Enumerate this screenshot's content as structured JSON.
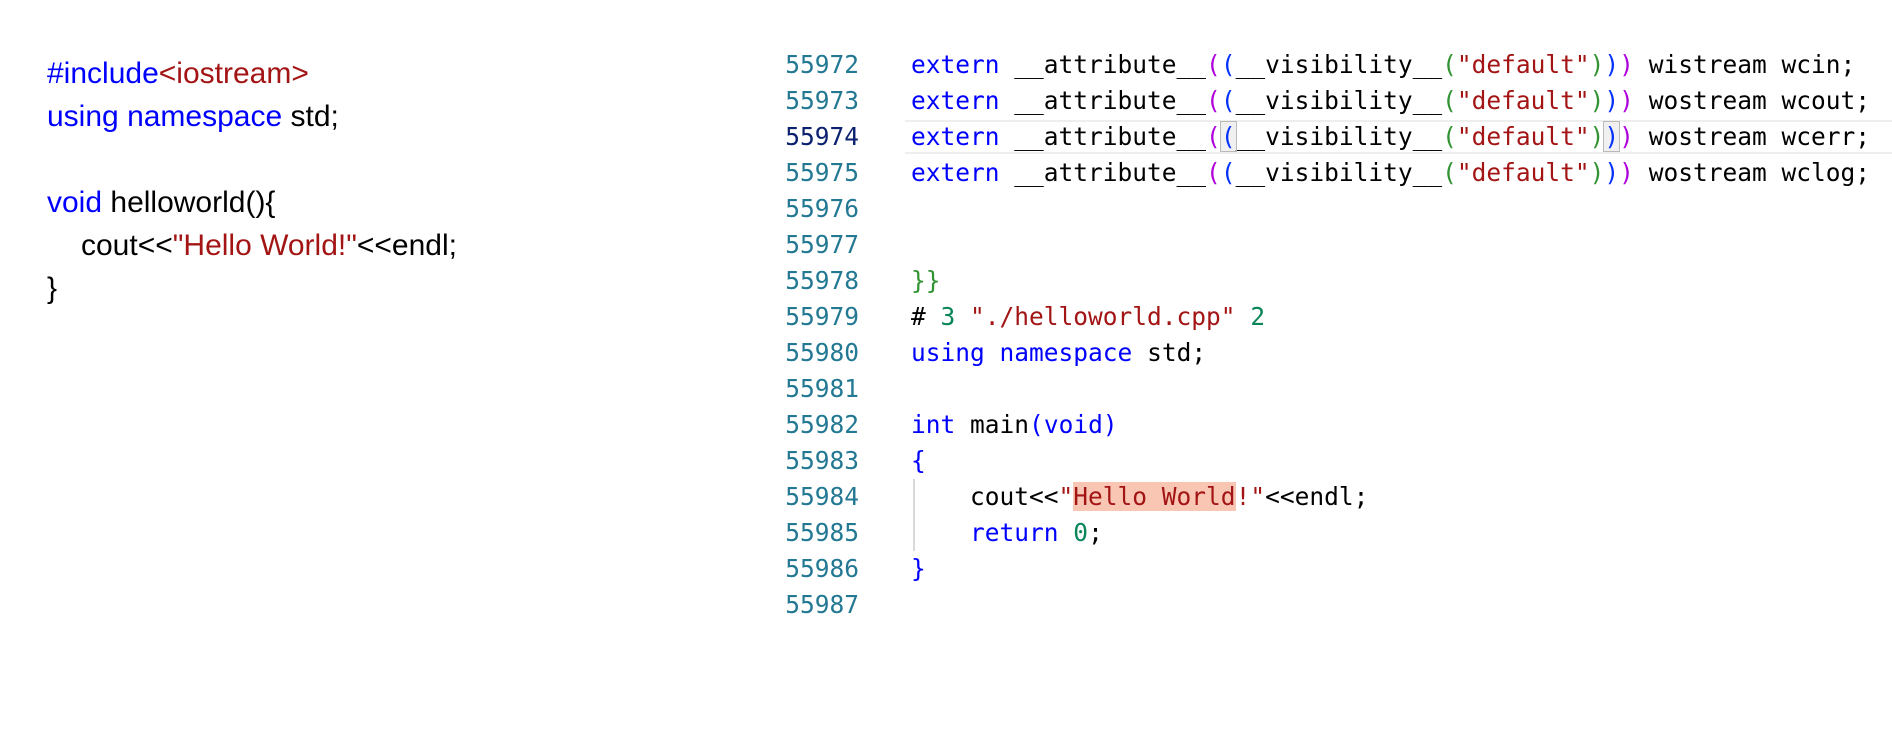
{
  "left_code": {
    "line1_kw": "#include",
    "line1_hdr": "<iostream>",
    "line2_kw1": "using",
    "line2_kw2": "namespace",
    "line2_rest": " std;",
    "line3_kw": "void",
    "line3_rest": " helloworld(){",
    "line4_pre": "cout<<",
    "line4_str": "\"Hello World!\"",
    "line4_post": "<<endl;",
    "line5": "}"
  },
  "right_code": {
    "line_numbers": [
      "55972",
      "55973",
      "55974",
      "55975",
      "55976",
      "55977",
      "55978",
      "55979",
      "55980",
      "55981",
      "55982",
      "55983",
      "55984",
      "55985",
      "55986",
      "55987"
    ],
    "extern_kw": "extern",
    "attribute": "__attribute__",
    "visibility": "__visibility__",
    "default_str": "\"default\"",
    "decls": [
      "wistream wcin;",
      "wostream wcout;",
      "wostream wcerr;",
      "wostream wclog;"
    ],
    "closing_braces": "}}",
    "preproc_hash": "# ",
    "preproc_num1": "3",
    "preproc_file": "\"./helloworld.cpp\"",
    "preproc_num2": "2",
    "using_kw": "using",
    "namespace_kw": "namespace",
    "std_rest": "std;",
    "int_kw": "int",
    "main_name": "main",
    "void_kw": "void",
    "open_brace": "{",
    "cout_pre": "cout<<",
    "quote": "\"",
    "hello_hl": "Hello World",
    "hello_tail": "!\"",
    "cout_post": "<<endl;",
    "return_kw": "return",
    "zero": "0",
    "semicolon": ";",
    "close_brace": "}"
  },
  "colors": {
    "keyword": "#0000ff",
    "string": "#a31515",
    "number": "#098658",
    "line_number": "#237893",
    "active_line_number": "#0b216f",
    "match_highlight": "#f9c6b3"
  }
}
